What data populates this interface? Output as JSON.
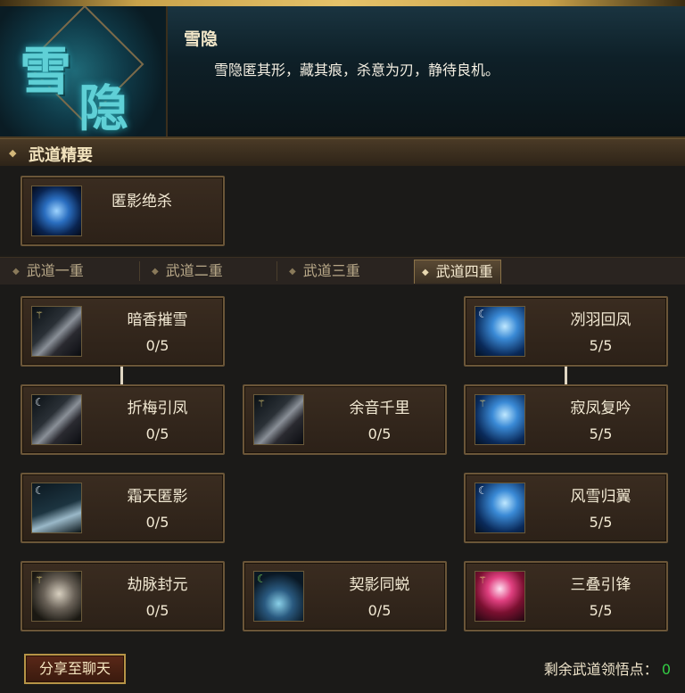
{
  "header": {
    "emblem_text": [
      "雪",
      "隐"
    ],
    "title": "雪隐",
    "description": "雪隐匿其形，藏其痕，杀意为刃，静待良机。"
  },
  "section": {
    "title": "武道精要",
    "essence_skill": {
      "name": "匿影绝杀",
      "icon": "essence-skill-icon"
    }
  },
  "tabs": [
    {
      "label": "武道一重",
      "active": false
    },
    {
      "label": "武道二重",
      "active": false
    },
    {
      "label": "武道三重",
      "active": false
    },
    {
      "label": "武道四重",
      "active": true
    }
  ],
  "skills": [
    {
      "name": "暗香摧雪",
      "level": "0/5",
      "icon": "blade-icon"
    },
    {
      "name": "冽羽回凤",
      "level": "5/5",
      "icon": "phoenix-feather-icon"
    },
    {
      "name": "折梅引凤",
      "level": "0/5",
      "icon": "blade-icon"
    },
    {
      "name": "余音千里",
      "level": "0/5",
      "icon": "blade-icon"
    },
    {
      "name": "寂凤复吟",
      "level": "5/5",
      "icon": "phoenix-feather-icon"
    },
    {
      "name": "霜天匿影",
      "level": "0/5",
      "icon": "frost-shadow-icon"
    },
    {
      "name": "风雪归翼",
      "level": "5/5",
      "icon": "phoenix-feather-icon"
    },
    {
      "name": "劫脉封元",
      "level": "0/5",
      "icon": "elder-portrait-icon"
    },
    {
      "name": "契影同蜕",
      "level": "0/5",
      "icon": "vortex-icon"
    },
    {
      "name": "三叠引锋",
      "level": "5/5",
      "icon": "crimson-burst-icon"
    }
  ],
  "footer": {
    "share_label": "分享至聊天",
    "remaining_label": "剩余武道领悟点：",
    "remaining_value": "0",
    "remaining_color": "#33cc44"
  }
}
